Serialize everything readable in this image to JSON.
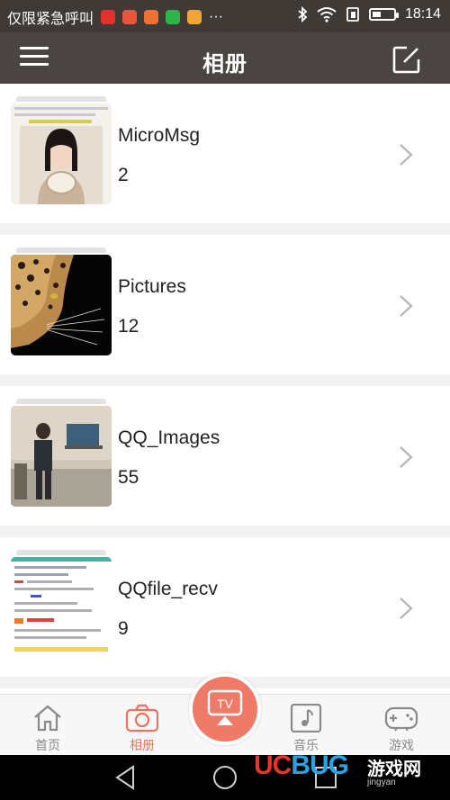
{
  "status_bar": {
    "carrier_text": "仅限紧急呼叫",
    "more_text": "···",
    "time": "18:14",
    "battery_level": 0.4,
    "app_icons": [
      {
        "name": "weibo-icon",
        "color": "#e6312b"
      },
      {
        "name": "mail-icon",
        "color": "#e8553c"
      },
      {
        "name": "health-icon",
        "color": "#ef7033"
      },
      {
        "name": "wechat-icon",
        "color": "#2fb44a"
      },
      {
        "name": "store-icon",
        "color": "#f0a53a"
      }
    ]
  },
  "header": {
    "title": "相册",
    "menu_icon": "hamburger-menu-icon",
    "edit_icon": "edit-icon"
  },
  "albums": [
    {
      "name": "MicroMsg",
      "count": "2",
      "thumb": "portrait-photo"
    },
    {
      "name": "Pictures",
      "count": "12",
      "thumb": "leopard-photo"
    },
    {
      "name": "QQ_Images",
      "count": "55",
      "thumb": "room-photo"
    },
    {
      "name": "QQfile_recv",
      "count": "9",
      "thumb": "document-screenshot"
    }
  ],
  "bottom_nav": {
    "items": [
      {
        "label": "首页",
        "icon": "home-icon",
        "active": false
      },
      {
        "label": "相册",
        "icon": "camera-icon",
        "active": true
      },
      {
        "label": "音乐",
        "icon": "music-icon",
        "active": false
      },
      {
        "label": "游戏",
        "icon": "gamepad-icon",
        "active": false
      }
    ],
    "center_label": "TV",
    "accent_color": "#f07060"
  },
  "watermark": {
    "brand_uc": "UC",
    "brand_bug": "BUG",
    "side_text": "游戏网",
    "site": "jingyan"
  }
}
